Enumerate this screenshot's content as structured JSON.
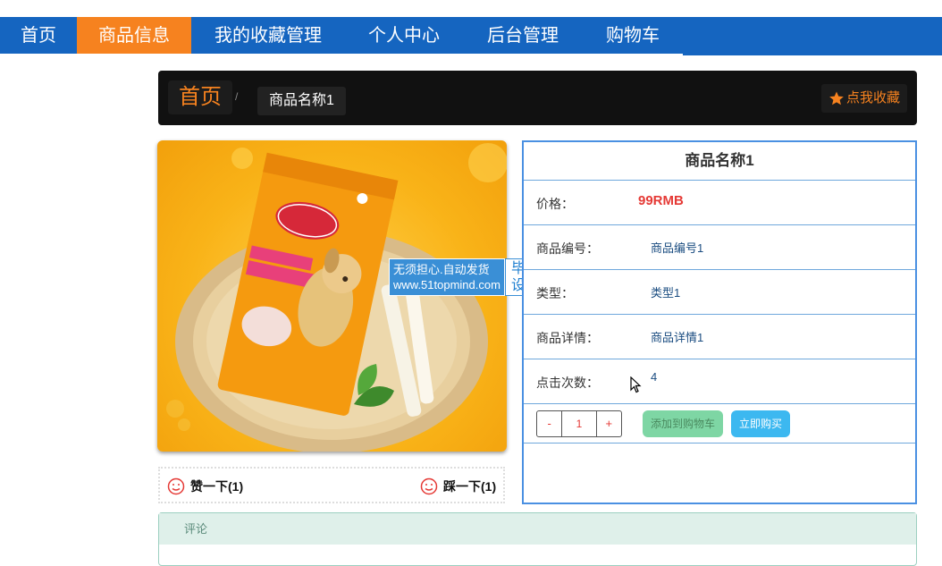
{
  "nav": {
    "items": [
      {
        "label": "首页",
        "active": false
      },
      {
        "label": "商品信息",
        "active": true
      },
      {
        "label": "我的收藏管理",
        "active": false
      },
      {
        "label": "个人中心",
        "active": false
      },
      {
        "label": "后台管理",
        "active": false
      },
      {
        "label": "购物车",
        "active": false
      }
    ]
  },
  "breadcrumb": {
    "home": "首页",
    "separator": "/",
    "current": "商品名称1",
    "favorite_label": "点我收藏",
    "favorite_icon": "star-icon"
  },
  "watermark": {
    "line1": "无须担心.自动发货",
    "line2": "www.51topmind.com",
    "side1": "毕业",
    "side2": "设计"
  },
  "votes": {
    "like_label": "赞一下(1)",
    "dislike_label": "踩一下(1)",
    "icon": "smiley-icon"
  },
  "product": {
    "title": "商品名称1",
    "rows": [
      {
        "label": "价格：",
        "value": "99RMB"
      },
      {
        "label": "商品编号：",
        "value": "商品编号1"
      },
      {
        "label": "类型：",
        "value": "类型1"
      },
      {
        "label": "商品详情：",
        "value": "商品详情1"
      },
      {
        "label": "点击次数：",
        "value": "4"
      }
    ]
  },
  "actions": {
    "minus": "-",
    "quantity": "1",
    "plus": "+",
    "add_to_cart": "添加到购物车",
    "buy_now": "立即购买"
  },
  "comments": {
    "title": "评论"
  },
  "colors": {
    "nav_bg": "#1565c0",
    "accent": "#f6821f",
    "price": "#e53935",
    "panel_border": "#4a90e2"
  }
}
